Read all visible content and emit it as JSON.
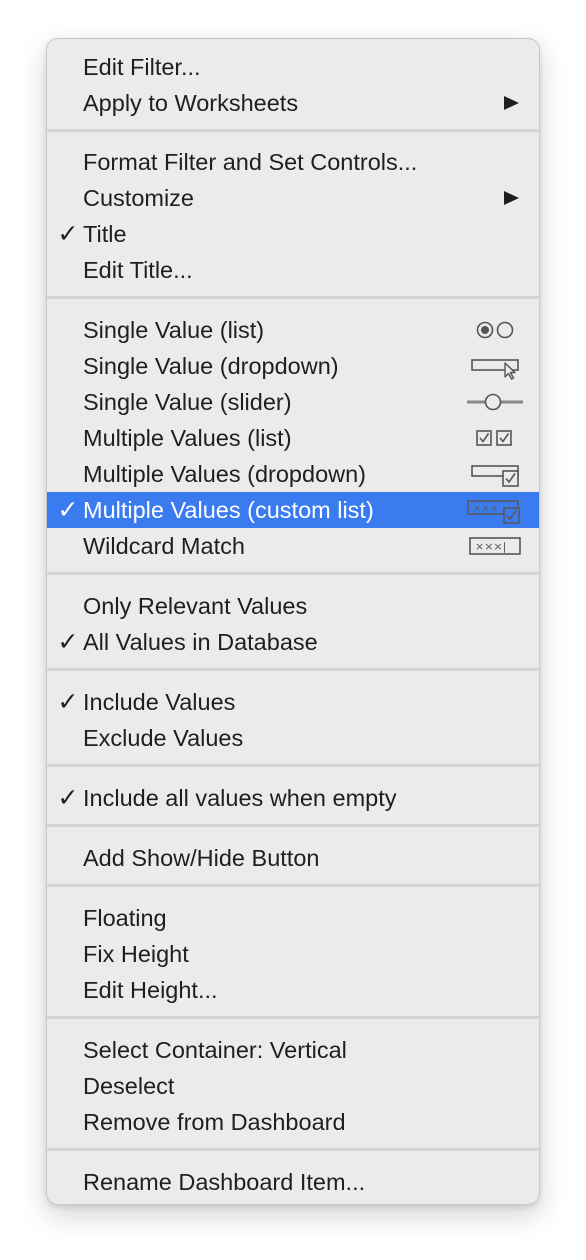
{
  "menu": {
    "items": [
      {
        "label": "Edit Filter...",
        "checked": false,
        "submenu": false
      },
      {
        "label": "Apply to Worksheets",
        "checked": false,
        "submenu": true
      },
      {
        "label": "Format Filter and Set Controls...",
        "checked": false,
        "submenu": false
      },
      {
        "label": "Customize",
        "checked": false,
        "submenu": true
      },
      {
        "label": "Title",
        "checked": true,
        "submenu": false
      },
      {
        "label": "Edit Title...",
        "checked": false,
        "submenu": false
      },
      {
        "label": "Single Value (list)",
        "checked": false,
        "icon": "radio-pair-icon"
      },
      {
        "label": "Single Value (dropdown)",
        "checked": false,
        "icon": "dropdown-cursor-icon"
      },
      {
        "label": "Single Value (slider)",
        "checked": false,
        "icon": "slider-icon"
      },
      {
        "label": "Multiple Values (list)",
        "checked": false,
        "icon": "checkbox-pair-icon"
      },
      {
        "label": "Multiple Values (dropdown)",
        "checked": false,
        "icon": "dropdown-check-icon"
      },
      {
        "label": "Multiple Values (custom list)",
        "checked": true,
        "highlighted": true,
        "icon": "custom-list-icon"
      },
      {
        "label": "Wildcard Match",
        "checked": false,
        "icon": "wildcard-icon"
      },
      {
        "label": "Only Relevant Values",
        "checked": false
      },
      {
        "label": "All Values in Database",
        "checked": true
      },
      {
        "label": "Include Values",
        "checked": true
      },
      {
        "label": "Exclude Values",
        "checked": false
      },
      {
        "label": "Include all values when empty",
        "checked": true
      },
      {
        "label": "Add Show/Hide Button",
        "checked": false
      },
      {
        "label": "Floating",
        "checked": false
      },
      {
        "label": "Fix Height",
        "checked": false
      },
      {
        "label": "Edit Height...",
        "checked": false
      },
      {
        "label": "Select Container: Vertical",
        "checked": false
      },
      {
        "label": "Deselect",
        "checked": false
      },
      {
        "label": "Remove from Dashboard",
        "checked": false
      },
      {
        "label": "Rename Dashboard Item...",
        "checked": false
      }
    ],
    "checkmark_glyph": "✓",
    "icon_text": {
      "custom_list": "×××",
      "wildcard": "×××|"
    },
    "colors": {
      "highlight": "#3b7bf0",
      "background": "#ebebeb",
      "text": "#1f1f1f"
    }
  }
}
